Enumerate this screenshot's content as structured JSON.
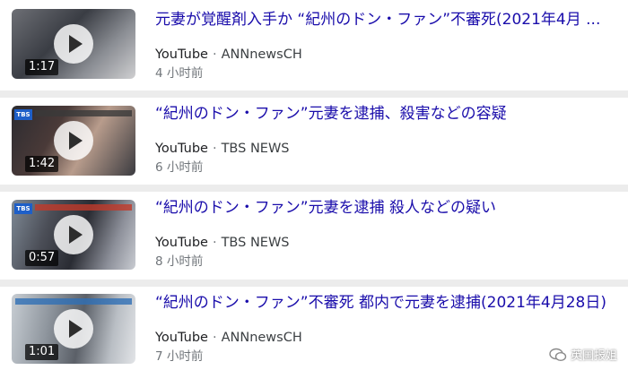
{
  "results": [
    {
      "title": "元妻が覚醒剤入手か “紀州のドン・ファン”不審死(2021年4月 ...",
      "site": "YouTube",
      "channel": "ANNnewsCH",
      "time": "4 小时前",
      "duration": "1:17"
    },
    {
      "title": "“紀州のドン・ファン”元妻を逮捕、殺害などの容疑",
      "site": "YouTube",
      "channel": "TBS NEWS",
      "time": "6 小时前",
      "duration": "1:42",
      "logo": "TBS"
    },
    {
      "title": "“紀州のドン・ファン”元妻を逮捕 殺人などの疑い",
      "site": "YouTube",
      "channel": "TBS NEWS",
      "time": "8 小时前",
      "duration": "0:57",
      "logo": "TBS"
    },
    {
      "title": "“紀州のドン・ファン”不審死 都内で元妻を逮捕(2021年4月28日)",
      "site": "YouTube",
      "channel": "ANNnewsCH",
      "time": "7 小时前",
      "duration": "1:01"
    }
  ],
  "watermark": "英国报姐",
  "colors": {
    "link": "#1a0dab",
    "meta": "#70757a",
    "divider": "#ececec"
  }
}
